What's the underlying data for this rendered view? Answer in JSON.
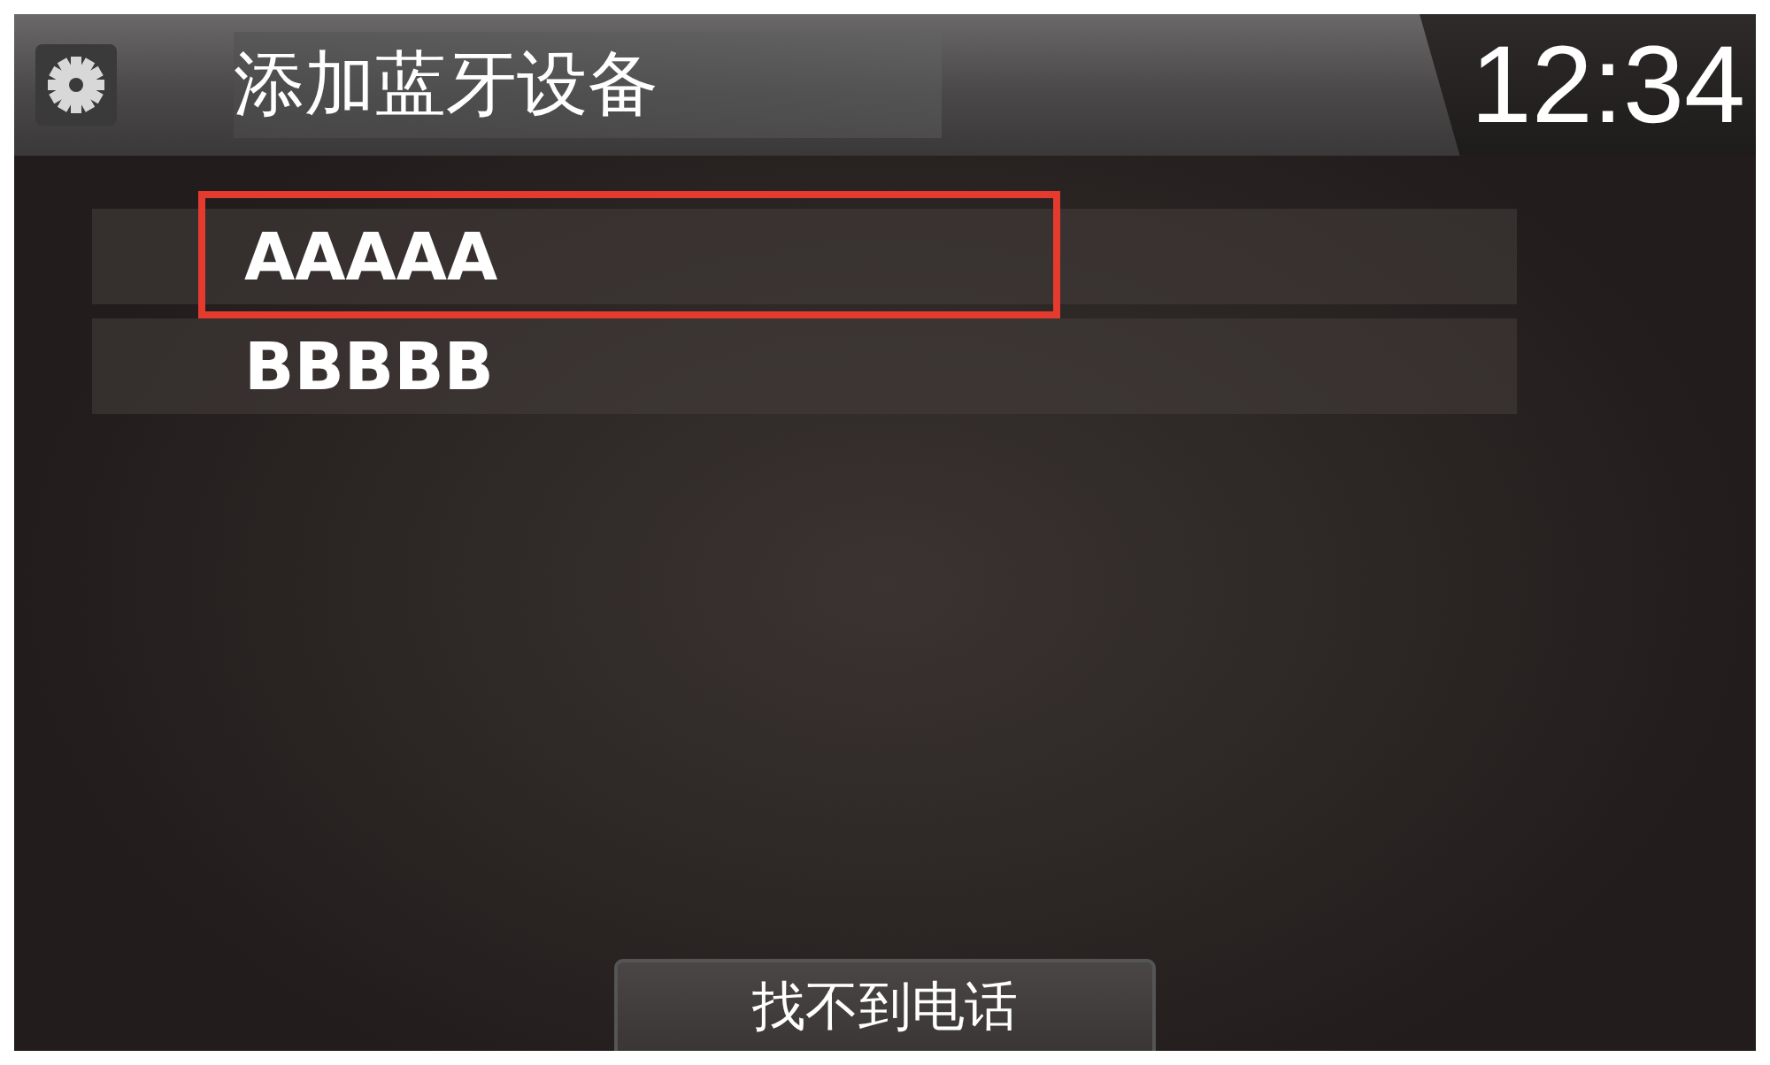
{
  "header": {
    "title": "添加蓝牙设备",
    "clock": "12:34"
  },
  "devices": [
    {
      "name": "AAAAA",
      "selected": true
    },
    {
      "name": "BBBBB",
      "selected": false
    }
  ],
  "button": {
    "label": "找不到电话"
  }
}
